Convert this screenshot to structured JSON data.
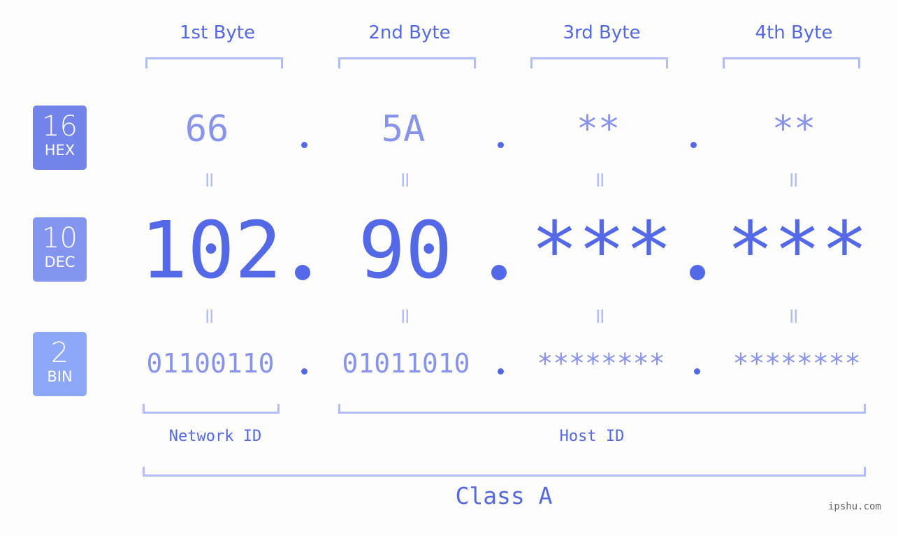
{
  "badges": [
    {
      "num": "16",
      "label": "HEX"
    },
    {
      "num": "10",
      "label": "DEC"
    },
    {
      "num": "2",
      "label": "BIN"
    }
  ],
  "bytes": [
    {
      "header": "1st Byte",
      "hex": "66",
      "dec": "102",
      "bin": "01100110"
    },
    {
      "header": "2nd Byte",
      "hex": "5A",
      "dec": "90",
      "bin": "01011010"
    },
    {
      "header": "3rd Byte",
      "hex": "**",
      "dec": "***",
      "bin": "********"
    },
    {
      "header": "4th Byte",
      "hex": "**",
      "dec": "***",
      "bin": "********"
    }
  ],
  "equals_glyph": "=",
  "parts": {
    "network": "Network ID",
    "host": "Host ID"
  },
  "class_label": "Class A",
  "watermark": "ipshu.com",
  "colors": {
    "accent": "#5469e8",
    "light": "#8894ec",
    "bracket": "#b3bdf7",
    "hex_badge": "#7283ea",
    "dec_badge": "#8495f0",
    "bin_badge": "#8da7f9"
  }
}
